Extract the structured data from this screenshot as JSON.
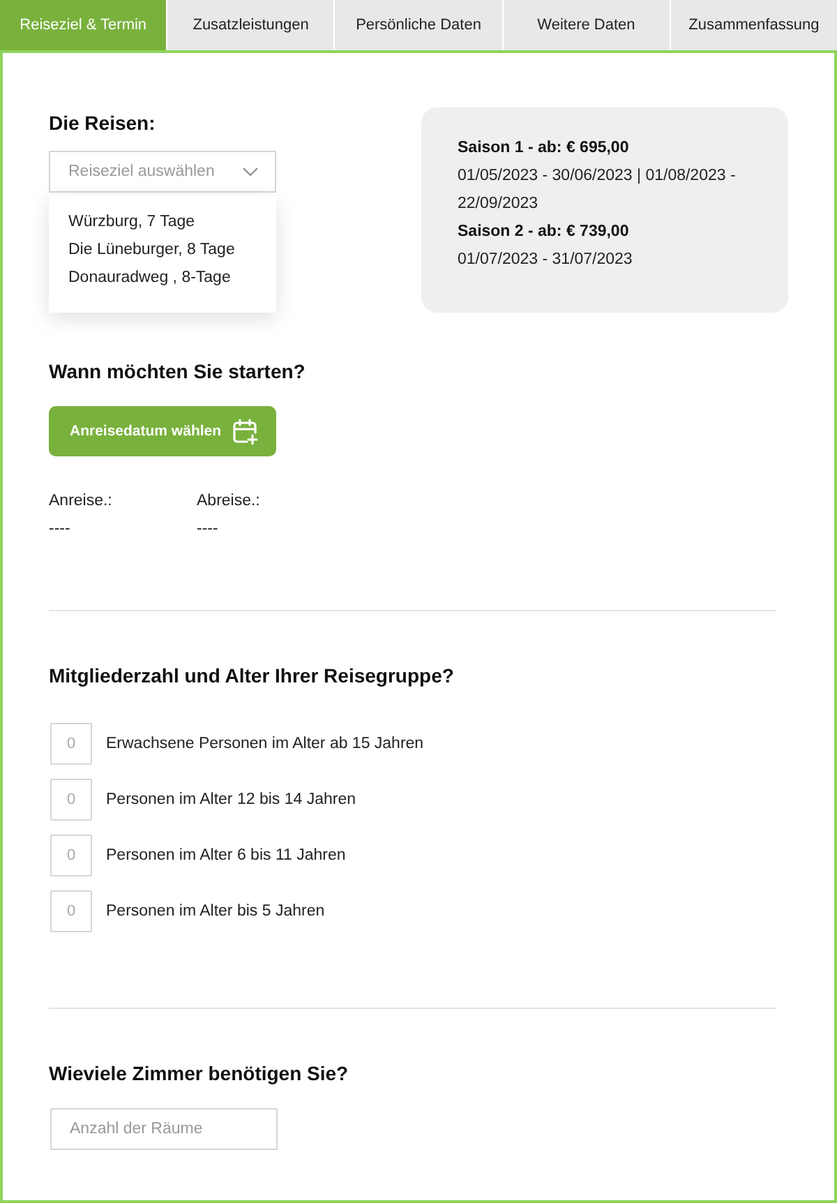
{
  "tabs": [
    {
      "label": "Reiseziel & Termin",
      "selected": true
    },
    {
      "label": "Zusatzleistungen",
      "selected": false
    },
    {
      "label": "Persönliche Daten",
      "selected": false
    },
    {
      "label": "Weitere Daten",
      "selected": false
    },
    {
      "label": "Zusammenfassung",
      "selected": false
    }
  ],
  "trips": {
    "heading": "Die Reisen:",
    "select": {
      "placeholder": "Reiseziel auswählen",
      "expanded": true,
      "options": [
        "Würzburg, 7 Tage",
        "Die Lüneburger, 8 Tage",
        "Donauradweg , 8-Tage"
      ]
    }
  },
  "season_card": {
    "seasons": [
      {
        "title": "Saison 1 - ab: € 695,00",
        "dates": "01/05/2023 - 30/06/2023 | 01/08/2023 - 22/09/2023"
      },
      {
        "title": "Saison 2 - ab: € 739,00",
        "dates": "01/07/2023 - 31/07/2023"
      }
    ]
  },
  "start": {
    "heading": "Wann möchten Sie starten?",
    "button": "Anreisedatum wählen",
    "dates": [
      {
        "label": "Anreise.:",
        "value": "----"
      },
      {
        "label": "Abreise.:",
        "value": "----"
      }
    ]
  },
  "group": {
    "heading": "Mitgliederzahl und Alter Ihrer Reisegruppe?",
    "rows": [
      {
        "placeholder": "0",
        "label": "Erwachsene Personen im Alter ab 15 Jahren"
      },
      {
        "placeholder": "0",
        "label": "Personen im Alter 12 bis 14 Jahren"
      },
      {
        "placeholder": "0",
        "label": "Personen im Alter 6 bis 11 Jahren"
      },
      {
        "placeholder": "0",
        "label": "Personen im Alter bis 5 Jahren"
      }
    ]
  },
  "rooms": {
    "heading": "Wieviele Zimmer benötigen Sie?",
    "field": {
      "placeholder": "Anzahl der Räume"
    }
  }
}
